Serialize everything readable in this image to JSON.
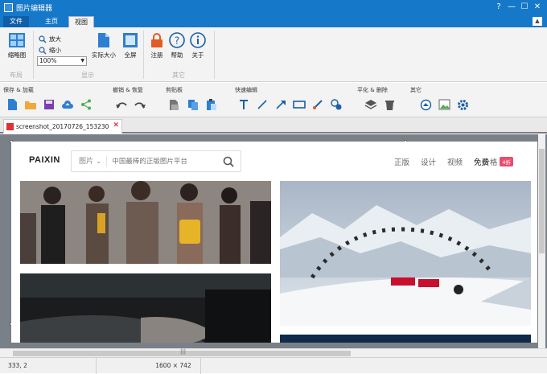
{
  "window": {
    "title": "图片编辑器",
    "controls": [
      "?",
      "—",
      "☐",
      "✕"
    ]
  },
  "ribbon_tabs": {
    "file": "文件",
    "home": "主页",
    "view": "视图"
  },
  "ribbon": {
    "layout": {
      "thumbnail": "缩略图",
      "group": "布局"
    },
    "display": {
      "zoom_in": "放大",
      "zoom_out": "缩小",
      "zoom_value": "100%",
      "actual_size": "实际大小",
      "fullscreen": "全屏",
      "group": "显示"
    },
    "other": {
      "register": "注册",
      "help": "帮助",
      "about": "关于",
      "group": "其它"
    }
  },
  "toolbar": {
    "save_load": "保存 & 加载",
    "undo_redo": "撤销 & 恢复",
    "clipboard": "剪贴板",
    "quick_edit": "快速编辑",
    "level_delete": "平化 & 删除",
    "other": "其它"
  },
  "doc_tab": {
    "name": "screenshot_20170726_153230"
  },
  "site": {
    "logo": "PAIXIN",
    "search_category": "图片",
    "search_placeholder": "中国最棒的正版图片平台",
    "nav": [
      "正版",
      "设计",
      "视频",
      "免费"
    ],
    "price": "价格",
    "price_badge": "4折"
  },
  "status": {
    "coords": "333, 2",
    "size": "1600 × 742"
  },
  "colors": {
    "titlebar": "#1678c8",
    "accent": "#1a73c5",
    "badge": "#ea4c6c"
  }
}
